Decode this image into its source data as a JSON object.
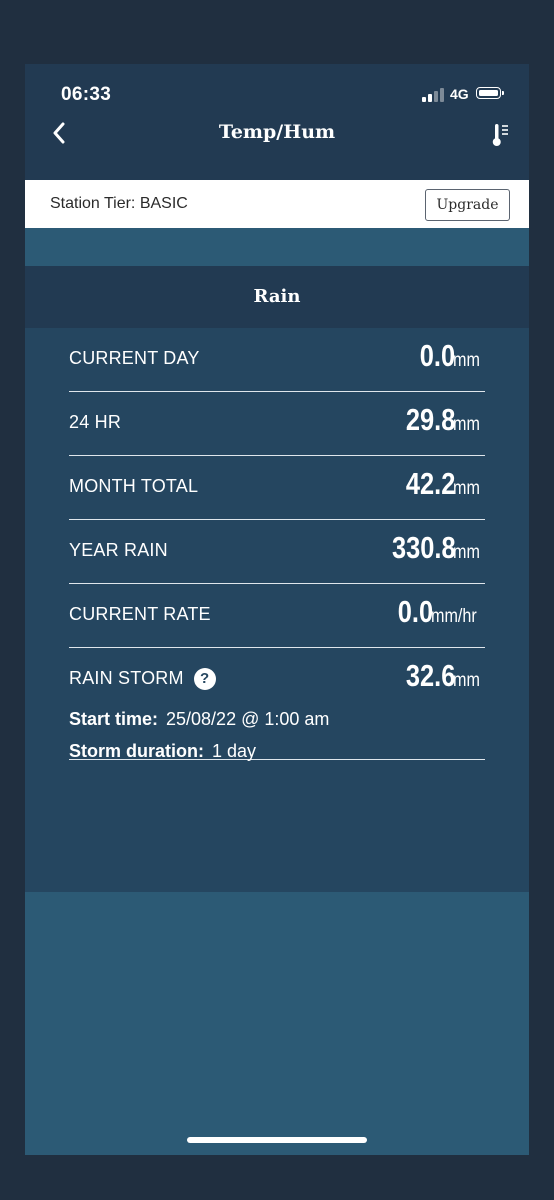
{
  "status_bar": {
    "time": "06:33",
    "network": "4G"
  },
  "nav": {
    "title": "Temp/Hum",
    "back_icon": "chevron-left-icon",
    "right_icon": "thermometer-list-icon"
  },
  "tier": {
    "text": "Station Tier: BASIC",
    "upgrade_label": "Upgrade"
  },
  "section": {
    "title": "Rain"
  },
  "rain": {
    "rows": [
      {
        "label": "CURRENT DAY",
        "value": "0.0",
        "unit": "mm"
      },
      {
        "label": "24 HR",
        "value": "29.8",
        "unit": "mm"
      },
      {
        "label": "MONTH TOTAL",
        "value": "42.2",
        "unit": "mm"
      },
      {
        "label": "YEAR RAIN",
        "value": "330.8",
        "unit": "mm"
      },
      {
        "label": "CURRENT RATE",
        "value": "0.0",
        "unit": "mm/hr"
      }
    ],
    "storm": {
      "label": "RAIN STORM",
      "help_glyph": "?",
      "value": "32.6",
      "unit": "mm",
      "start_label": "Start time:",
      "start_value": "25/08/22 @ 1:00 am",
      "duration_label": "Storm duration:",
      "duration_value": "1 day"
    }
  },
  "colors": {
    "background": "#202f40",
    "header": "#223a52",
    "panel": "#254660",
    "accent": "#2c5a75",
    "text": "#ffffff"
  }
}
